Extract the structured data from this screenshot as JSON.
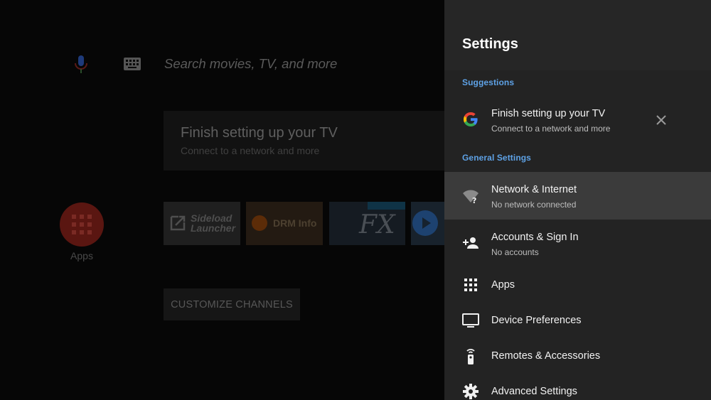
{
  "home": {
    "search_placeholder": "Search movies, TV, and more",
    "recommendation": {
      "title": "Finish setting up your TV",
      "subtitle": "Connect to a network and more"
    },
    "apps_label": "Apps",
    "tiles": {
      "sideload_line1": "Sideload",
      "sideload_line2": "Launcher",
      "drm": "DRM Info",
      "fx": "FX"
    },
    "customize_label": "CUSTOMIZE CHANNELS"
  },
  "settings": {
    "title": "Settings",
    "suggestions_header": "Suggestions",
    "suggestion": {
      "title": "Finish setting up your TV",
      "subtitle": "Connect to a network and more",
      "icon": "google-g-icon"
    },
    "general_header": "General Settings",
    "items": [
      {
        "title": "Network & Internet",
        "subtitle": "No network connected",
        "icon": "wifi-off-icon",
        "focused": true
      },
      {
        "title": "Accounts & Sign In",
        "subtitle": "No accounts",
        "icon": "person-add-icon"
      },
      {
        "title": "Apps",
        "icon": "apps-grid-icon"
      },
      {
        "title": "Device Preferences",
        "icon": "tv-icon"
      },
      {
        "title": "Remotes & Accessories",
        "icon": "remote-icon"
      },
      {
        "title": "Advanced Settings",
        "icon": "gear-icon"
      }
    ]
  },
  "colors": {
    "accent_blue": "#5ea2e6",
    "panel_bg": "#232323",
    "focused_row": "#3b3b3b"
  }
}
